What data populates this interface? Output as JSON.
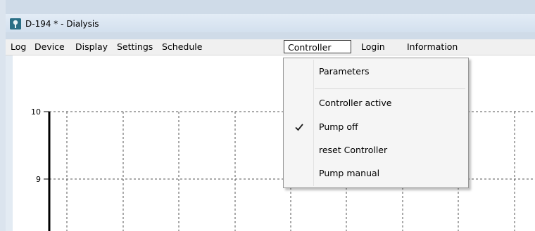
{
  "window": {
    "title": "D-194 * - Dialysis",
    "app_icon": "dialysis-app-icon"
  },
  "menubar": {
    "items": [
      {
        "label": "Log"
      },
      {
        "label": "Device"
      },
      {
        "label": "Display"
      },
      {
        "label": "Settings"
      },
      {
        "label": "Schedule"
      },
      {
        "label": "Controller",
        "open": true
      },
      {
        "label": "Login"
      },
      {
        "label": "Information"
      }
    ]
  },
  "controller_menu": {
    "items": [
      {
        "label": "Parameters",
        "checked": false
      },
      {
        "label": "Controller active",
        "checked": false
      },
      {
        "label": "Pump off",
        "checked": true
      },
      {
        "label": "reset Controller",
        "checked": false
      },
      {
        "label": "Pump manual",
        "checked": false
      }
    ],
    "check_icon": "checkmark-icon"
  },
  "chart_data": {
    "type": "line",
    "y_tick_labels": [
      "10",
      "9"
    ],
    "grid": "dashed",
    "series": []
  }
}
